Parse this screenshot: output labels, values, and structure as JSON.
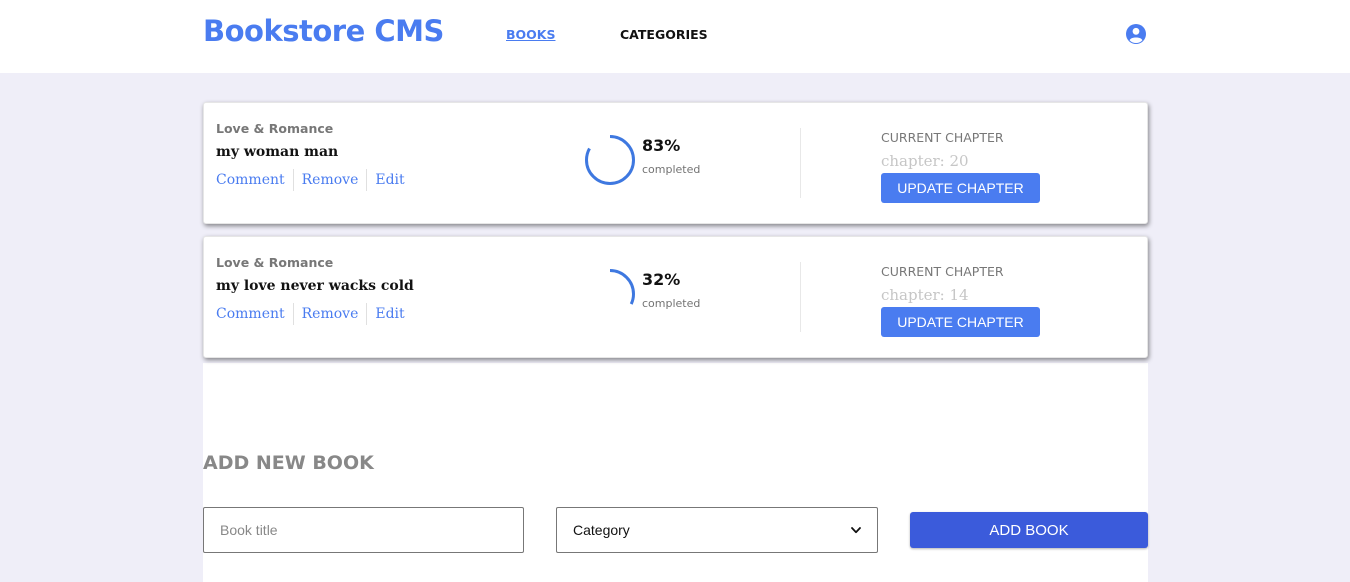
{
  "header": {
    "brand": "Bookstore CMS",
    "nav": {
      "books": "BOOKS",
      "categories": "CATEGORIES"
    },
    "user_icon": "user-circle-icon",
    "accent_color": "#4a7cf0"
  },
  "books": [
    {
      "genre": "Love & Romance",
      "title": "my woman man",
      "actions": {
        "comment": "Comment",
        "remove": "Remove",
        "edit": "Edit"
      },
      "progress": {
        "percent_label": "83%",
        "fraction": 0.83,
        "status": "completed"
      },
      "chapter": {
        "label": "CURRENT CHAPTER",
        "value": "chapter: 20",
        "button": "UPDATE CHAPTER"
      }
    },
    {
      "genre": "Love & Romance",
      "title": "my love never wacks cold",
      "actions": {
        "comment": "Comment",
        "remove": "Remove",
        "edit": "Edit"
      },
      "progress": {
        "percent_label": "32%",
        "fraction": 0.32,
        "status": "completed"
      },
      "chapter": {
        "label": "CURRENT CHAPTER",
        "value": "chapter: 14",
        "button": "UPDATE CHAPTER"
      }
    }
  ],
  "add_form": {
    "heading": "ADD NEW BOOK",
    "title_placeholder": "Book title",
    "category_selected": "Category",
    "submit": "ADD BOOK",
    "submit_color": "#3b5bdb"
  }
}
